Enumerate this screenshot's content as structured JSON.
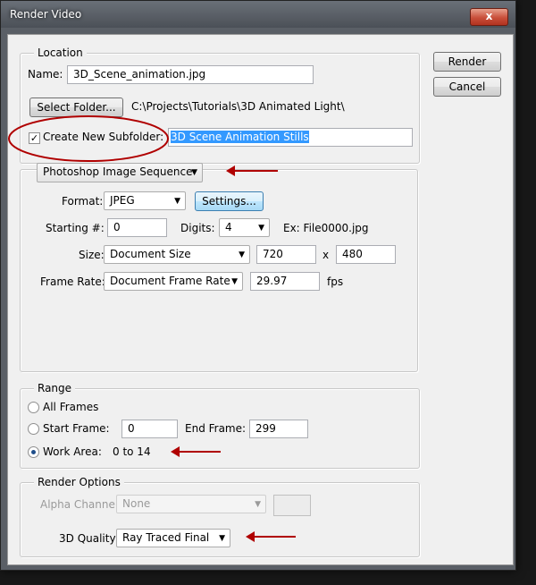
{
  "window": {
    "title": "Render Video",
    "close_glyph": "x"
  },
  "buttons": {
    "render": "Render",
    "cancel": "Cancel"
  },
  "location": {
    "legend": "Location",
    "name_label": "Name:",
    "name_value": "3D_Scene_animation.jpg",
    "select_folder": "Select Folder...",
    "folder_path": "C:\\Projects\\Tutorials\\3D Animated Light\\",
    "subfolder_label": "Create New Subfolder:",
    "subfolder_checked": true,
    "subfolder_value": "3D Scene Animation Stills"
  },
  "export": {
    "type": "Photoshop Image Sequence",
    "format_label": "Format:",
    "format_value": "JPEG",
    "settings_button": "Settings...",
    "starting_label": "Starting #:",
    "starting_value": "0",
    "digits_label": "Digits:",
    "digits_value": "4",
    "example": "Ex: File0000.jpg",
    "size_label": "Size:",
    "size_value": "Document Size",
    "width": "720",
    "x_sep": "x",
    "height": "480",
    "framerate_label": "Frame Rate:",
    "framerate_value": "Document Frame Rate",
    "fps_value": "29.97",
    "fps_unit": "fps"
  },
  "range": {
    "legend": "Range",
    "all_frames": "All Frames",
    "start_frame_label": "Start Frame:",
    "start_frame_value": "0",
    "end_frame_label": "End Frame:",
    "end_frame_value": "299",
    "work_area_label": "Work Area:",
    "work_area_value": "0 to 14",
    "selected": "Work Area"
  },
  "render_options": {
    "legend": "Render Options",
    "alpha_label": "Alpha Channel:",
    "alpha_value": "None",
    "quality_label": "3D Quality:",
    "quality_value": "Ray Traced Final"
  },
  "colors": {
    "annotation": "#b00000",
    "selection": "#3399ff"
  }
}
